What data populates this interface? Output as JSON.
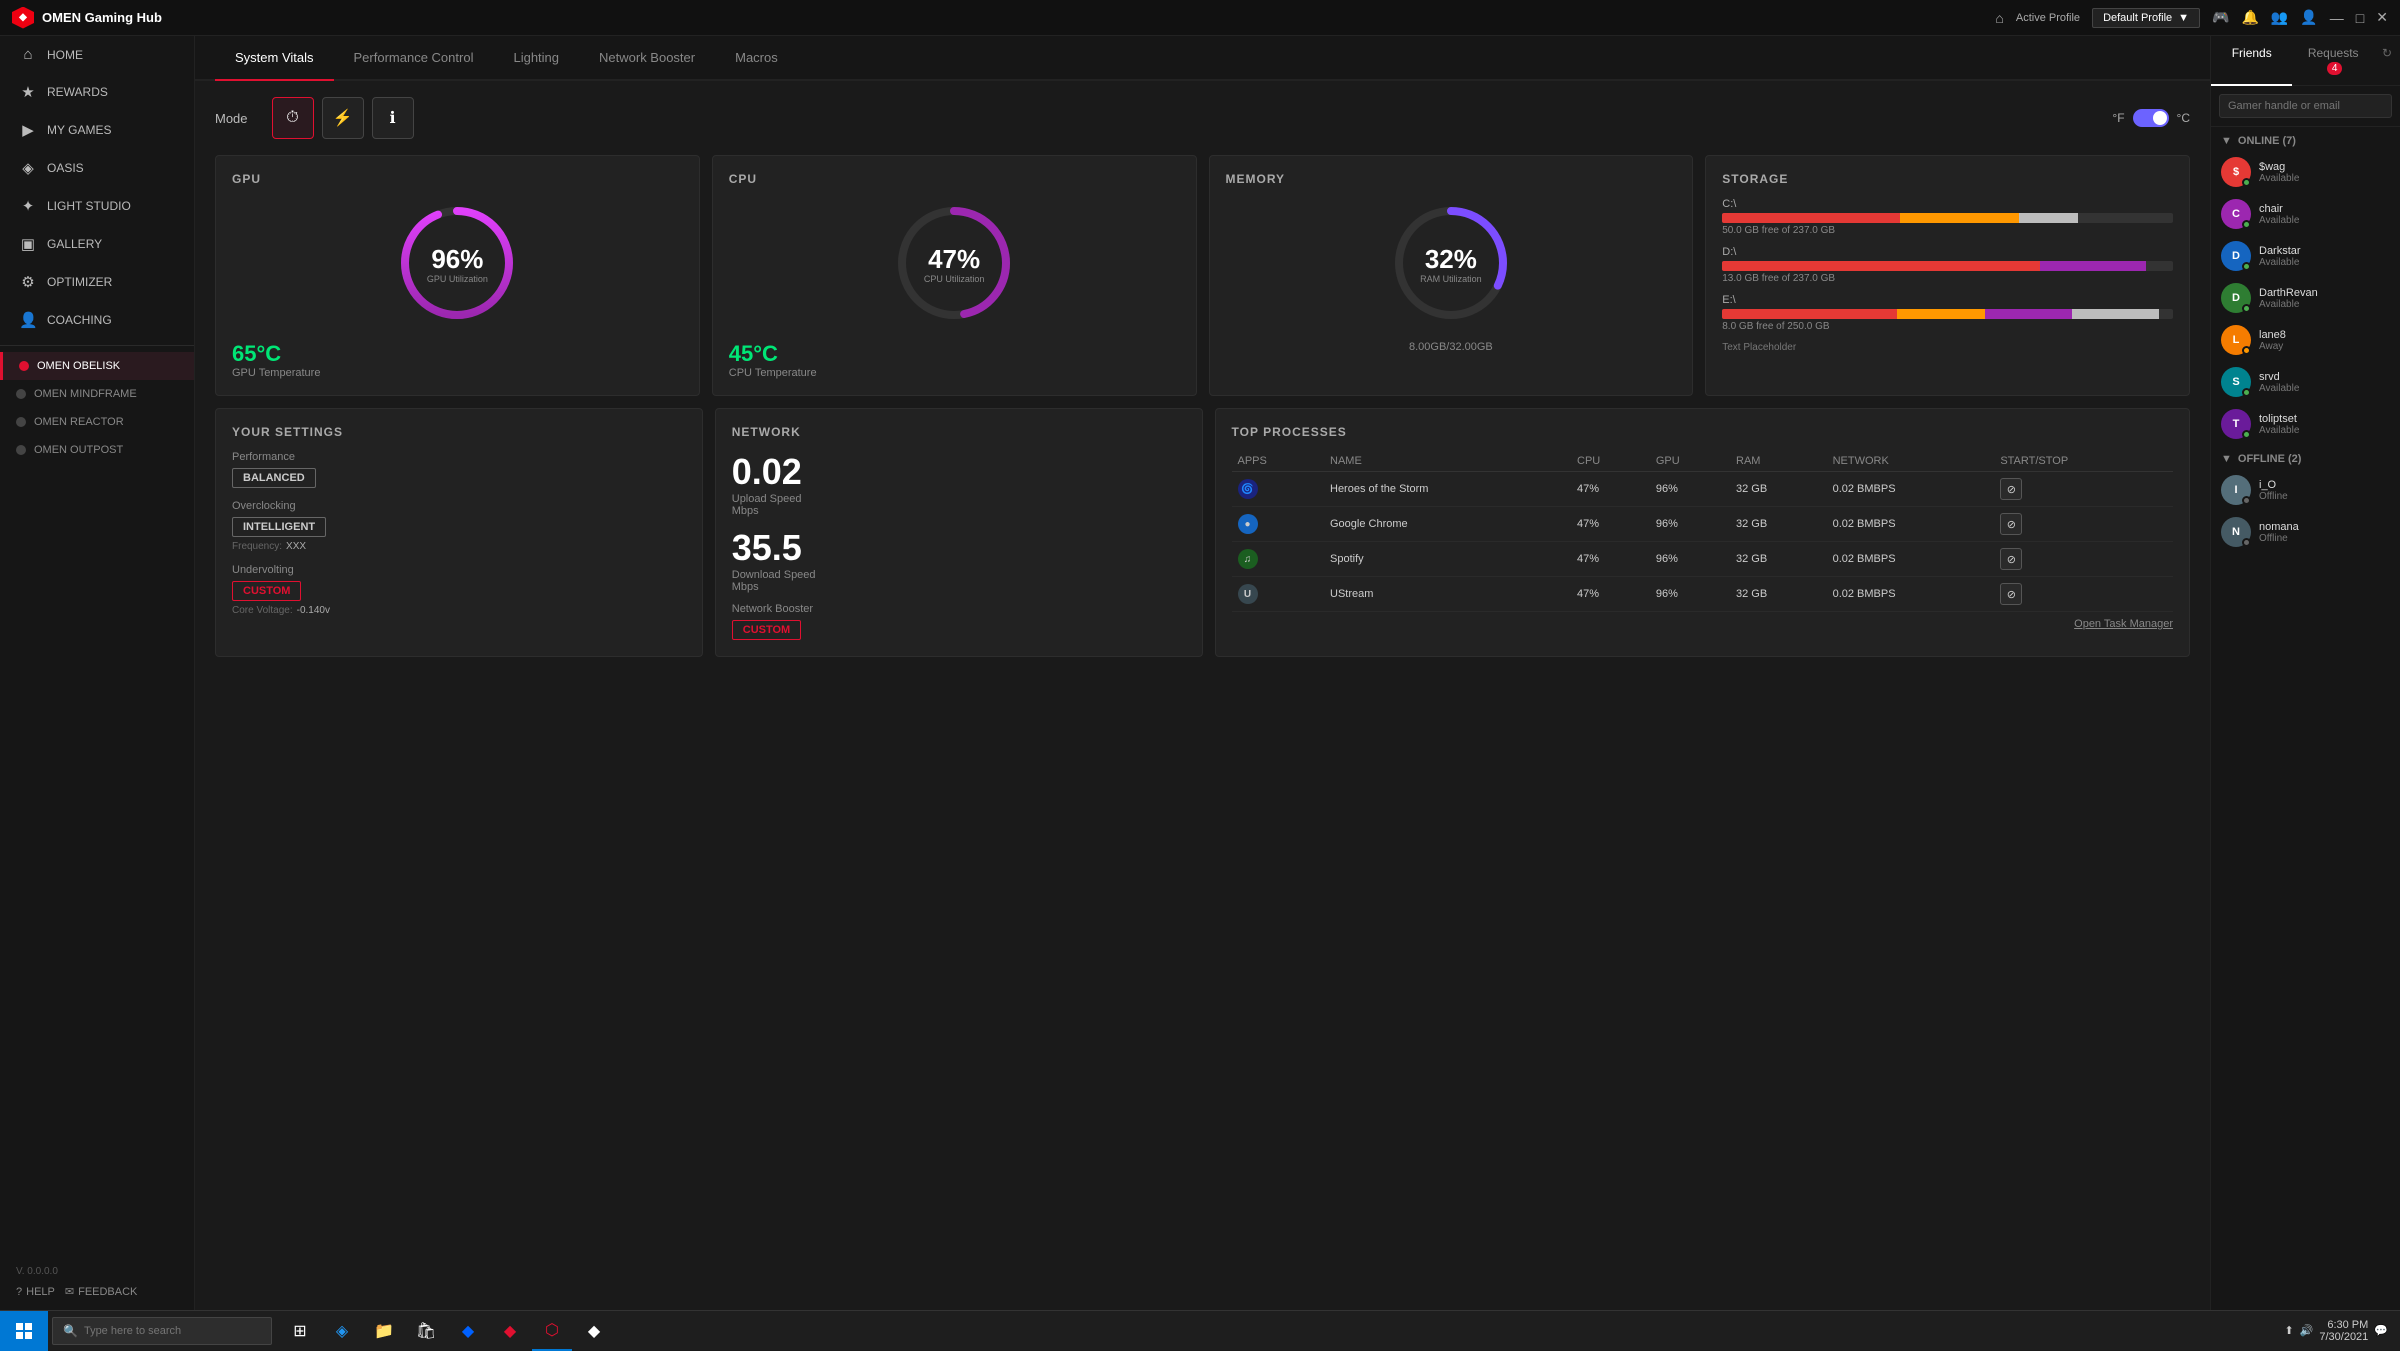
{
  "app": {
    "title": "OMEN Gaming Hub",
    "logo_icon": "⬡",
    "version": "V. 0.0.0.0"
  },
  "titlebar": {
    "active_profile_label": "Active Profile",
    "profile_name": "Default Profile"
  },
  "sidebar": {
    "items": [
      {
        "id": "home",
        "label": "HOME",
        "icon": "⌂"
      },
      {
        "id": "rewards",
        "label": "REWARDS",
        "icon": "★"
      },
      {
        "id": "my-games",
        "label": "MY GAMES",
        "icon": "▶"
      },
      {
        "id": "oasis",
        "label": "OASIS",
        "icon": "◈"
      },
      {
        "id": "light-studio",
        "label": "LIGHT STUDIO",
        "icon": "✦"
      },
      {
        "id": "gallery",
        "label": "GALLERY",
        "icon": "▣"
      },
      {
        "id": "optimizer",
        "label": "OPTIMIZER",
        "icon": "⚙"
      },
      {
        "id": "coaching",
        "label": "COACHING",
        "icon": "👤"
      }
    ],
    "devices": [
      {
        "id": "omen-obelisk",
        "label": "OMEN OBELISK",
        "active": true
      },
      {
        "id": "omen-mindframe",
        "label": "OMEN MINDFRAME",
        "active": false
      },
      {
        "id": "omen-reactor",
        "label": "OMEN REACTOR",
        "active": false
      },
      {
        "id": "omen-outpost",
        "label": "OMEN OUTPOST",
        "active": false
      }
    ],
    "footer": {
      "help": "HELP",
      "feedback": "FEEDBACK"
    }
  },
  "tabs": [
    {
      "id": "system-vitals",
      "label": "System Vitals",
      "active": true
    },
    {
      "id": "performance-control",
      "label": "Performance Control",
      "active": false
    },
    {
      "id": "lighting",
      "label": "Lighting",
      "active": false
    },
    {
      "id": "network-booster",
      "label": "Network Booster",
      "active": false
    },
    {
      "id": "macros",
      "label": "Macros",
      "active": false
    }
  ],
  "mode": {
    "label": "Mode",
    "icons": [
      "⏱",
      "⚡",
      "ℹ"
    ],
    "temp_label_f": "°F",
    "temp_label_c": "°C"
  },
  "gpu": {
    "title": "GPU",
    "percent": 96,
    "utilization_label": "GPU Utilization",
    "temp": "65°C",
    "temp_label": "GPU Temperature",
    "gauge_color_start": "#9c27b0",
    "gauge_color_end": "#e040fb"
  },
  "cpu": {
    "title": "CPU",
    "percent": 47,
    "utilization_label": "CPU Utilization",
    "temp": "45°C",
    "temp_label": "CPU Temperature",
    "gauge_color": "#9c27b0"
  },
  "memory": {
    "title": "MEMORY",
    "percent": 32,
    "utilization_label": "RAM Utilization",
    "used": "8.00GB",
    "total": "32.00GB",
    "info": "8.00GB/32.00GB",
    "gauge_color": "#7c4dff"
  },
  "storage": {
    "title": "STORAGE",
    "placeholder": "Text Placeholder",
    "drives": [
      {
        "label": "C:\\",
        "free": "50.0 GB free of 237.0 GB",
        "pct_used": 79,
        "colors": [
          "#e53935",
          "#ff9800",
          "#bdbdbd"
        ]
      },
      {
        "label": "D:\\",
        "free": "13.0 GB free of 237.0 GB",
        "pct_used": 94,
        "colors": [
          "#e53935",
          "#9c27b0"
        ]
      },
      {
        "label": "E:\\",
        "free": "8.0 GB free of 250.0 GB",
        "pct_used": 97,
        "colors": [
          "#e53935",
          "#ff9800",
          "#9c27b0",
          "#bdbdbd"
        ]
      }
    ]
  },
  "settings": {
    "title": "YOUR SETTINGS",
    "performance_label": "Performance",
    "performance_value": "BALANCED",
    "overclocking_label": "Overclocking",
    "overclocking_value": "INTELLIGENT",
    "frequency_label": "Frequency:",
    "frequency_value": "XXX",
    "undervolting_label": "Undervolting",
    "undervolting_value": "CUSTOM",
    "core_voltage_label": "Core Voltage:",
    "core_voltage_value": "-0.140v"
  },
  "network": {
    "title": "NETWORK",
    "upload_speed": "0.02",
    "upload_label": "Upload Speed",
    "upload_unit": "Mbps",
    "download_speed": "35.5",
    "download_label": "Download Speed",
    "download_unit": "Mbps",
    "booster_label": "Network Booster",
    "booster_value": "CUSTOM"
  },
  "processes": {
    "title": "TOP PROCESSES",
    "columns": [
      "APPS",
      "NAME",
      "CPU",
      "GPU",
      "RAM",
      "NETWORK",
      "START/STOP"
    ],
    "rows": [
      {
        "icon": "🌀",
        "icon_bg": "#1a237e",
        "name": "Heroes of the Storm",
        "cpu": "47%",
        "gpu": "96%",
        "ram": "32 GB",
        "network": "0.02 BMBPS"
      },
      {
        "icon": "●",
        "icon_bg": "#1565c0",
        "name": "Google Chrome",
        "cpu": "47%",
        "gpu": "96%",
        "ram": "32 GB",
        "network": "0.02 BMBPS"
      },
      {
        "icon": "♫",
        "icon_bg": "#1b5e20",
        "name": "Spotify",
        "cpu": "47%",
        "gpu": "96%",
        "ram": "32 GB",
        "network": "0.02 BMBPS"
      },
      {
        "icon": "U",
        "icon_bg": "#37474f",
        "name": "UStream",
        "cpu": "47%",
        "gpu": "96%",
        "ram": "32 GB",
        "network": "0.02 BMBPS"
      }
    ],
    "open_task_manager": "Open Task Manager"
  },
  "friends": {
    "friends_tab": "Friends",
    "requests_tab": "Requests",
    "requests_count": "4",
    "search_placeholder": "Gamer handle or email",
    "online_section": "ONLINE (7)",
    "offline_section": "OFFLINE (2)",
    "online_friends": [
      {
        "name": "$wag",
        "status": "Available",
        "online": "online",
        "color": "#e53935"
      },
      {
        "name": "chair",
        "status": "Available",
        "online": "online",
        "color": "#9c27b0"
      },
      {
        "name": "Darkstar",
        "status": "Available",
        "online": "online",
        "color": "#1565c0"
      },
      {
        "name": "DarthRevan",
        "status": "Available",
        "online": "online",
        "color": "#2e7d32"
      },
      {
        "name": "lane8",
        "status": "Away",
        "online": "away",
        "color": "#f57c00"
      },
      {
        "name": "srvd",
        "status": "Available",
        "online": "online",
        "color": "#00838f"
      },
      {
        "name": "toliptset",
        "status": "Available",
        "online": "online",
        "color": "#6a1b9a"
      }
    ],
    "offline_friends": [
      {
        "name": "i_O",
        "status": "Offline",
        "online": "offline",
        "color": "#546e7a"
      },
      {
        "name": "nomana",
        "status": "Offline",
        "online": "offline",
        "color": "#455a64"
      }
    ]
  },
  "taskbar": {
    "search_placeholder": "Type here to search",
    "time": "6:30 PM",
    "date": "7/30/2021"
  }
}
